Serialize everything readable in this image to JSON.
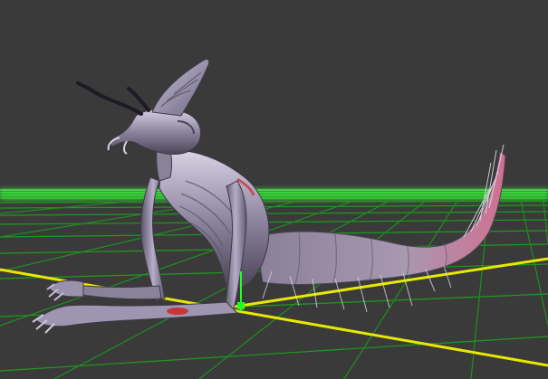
{
  "viewport": {
    "background_color": "#3a3a3a",
    "grid_major_color": "#22dd22",
    "grid_minor_color": "#1c8a1c",
    "horizon_glow_color": "#3cff3c",
    "axis_x_color": "#e8e800",
    "axis_z_color": "#e8e800",
    "model_base_color": "#8e86a0",
    "model_highlight_color": "#d8d2e4",
    "model_shadow_color": "#4a4456",
    "accent_red_color": "#cc2a2a",
    "tail_pink_color": "#d07090",
    "gizmo_green_color": "#22ff22"
  },
  "model": {
    "icon": "insectoid-creature-icon"
  }
}
